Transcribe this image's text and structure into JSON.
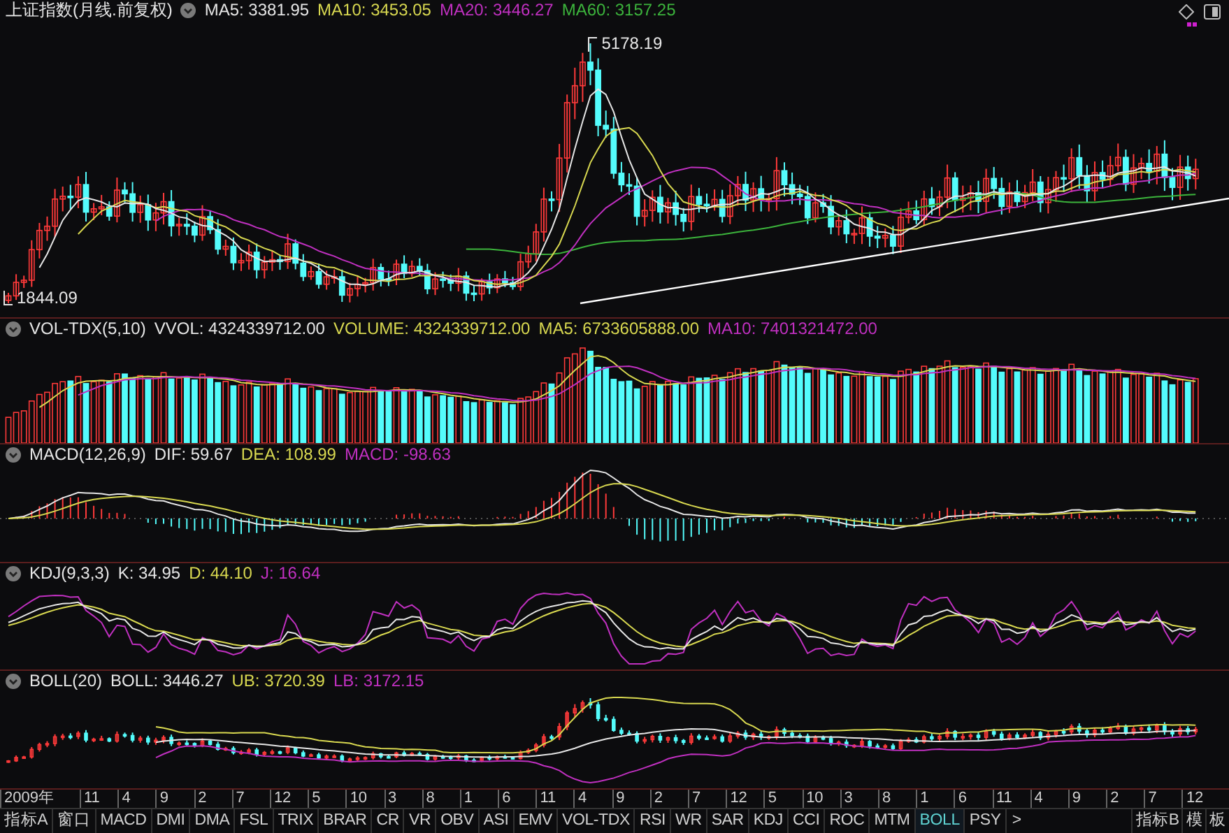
{
  "main_chart": {
    "title": "上证指数(月线.前复权)",
    "readings": [
      {
        "text": "MA5: 3381.95",
        "color": "#e6e6e6"
      },
      {
        "text": "MA10: 3453.05",
        "color": "#d8d850"
      },
      {
        "text": "MA20: 3446.27",
        "color": "#c030c0"
      },
      {
        "text": "MA60: 3157.25",
        "color": "#3cb43c"
      }
    ],
    "high_label": "5178.19",
    "low_label": "1844.09"
  },
  "indicators": [
    {
      "kind": "volume",
      "name": "VOL-TDX(5,10)",
      "readings": [
        {
          "text": "VVOL: 4324339712.00",
          "color": "#e6e6e6"
        },
        {
          "text": "VOLUME: 4324339712.00",
          "color": "#d8d850"
        },
        {
          "text": "MA5: 6733605888.00",
          "color": "#d8d850"
        },
        {
          "text": "MA10: 7401321472.00",
          "color": "#c030c0"
        }
      ]
    },
    {
      "kind": "macd",
      "name": "MACD(12,26,9)",
      "readings": [
        {
          "text": "DIF: 59.67",
          "color": "#e6e6e6"
        },
        {
          "text": "DEA: 108.99",
          "color": "#d8d850"
        },
        {
          "text": "MACD: -98.63",
          "color": "#c030c0"
        }
      ]
    },
    {
      "kind": "kdj",
      "name": "KDJ(9,3,3)",
      "readings": [
        {
          "text": "K: 34.95",
          "color": "#e6e6e6"
        },
        {
          "text": "D: 44.10",
          "color": "#d8d850"
        },
        {
          "text": "J: 16.64",
          "color": "#c030c0"
        }
      ]
    },
    {
      "kind": "boll",
      "name": "BOLL(20)",
      "readings": [
        {
          "text": "BOLL: 3446.27",
          "color": "#e6e6e6"
        },
        {
          "text": "UB: 3720.39",
          "color": "#d8d850"
        },
        {
          "text": "LB: 3172.15",
          "color": "#c030c0"
        }
      ]
    }
  ],
  "x_axis": [
    "2009年",
    "11",
    "4",
    "9",
    "2",
    "7",
    "12",
    "5",
    "10",
    "3",
    "8",
    "1",
    "6",
    "11",
    "4",
    "9",
    "2",
    "7",
    "12",
    "5",
    "10",
    "3",
    "8",
    "1",
    "6",
    "11",
    "4",
    "9",
    "2",
    "7",
    "12"
  ],
  "left_tabs": [
    {
      "label": "指标A",
      "selected": false
    },
    {
      "label": "窗口",
      "selected": false
    }
  ],
  "tabs": [
    {
      "label": "MACD",
      "selected": false
    },
    {
      "label": "DMI",
      "selected": false
    },
    {
      "label": "DMA",
      "selected": false
    },
    {
      "label": "FSL",
      "selected": false
    },
    {
      "label": "TRIX",
      "selected": false
    },
    {
      "label": "BRAR",
      "selected": false
    },
    {
      "label": "CR",
      "selected": false
    },
    {
      "label": "VR",
      "selected": false
    },
    {
      "label": "OBV",
      "selected": false
    },
    {
      "label": "ASI",
      "selected": false
    },
    {
      "label": "EMV",
      "selected": false
    },
    {
      "label": "VOL-TDX",
      "selected": false
    },
    {
      "label": "RSI",
      "selected": false
    },
    {
      "label": "WR",
      "selected": false
    },
    {
      "label": "SAR",
      "selected": false
    },
    {
      "label": "KDJ",
      "selected": false
    },
    {
      "label": "CCI",
      "selected": false
    },
    {
      "label": "ROC",
      "selected": false
    },
    {
      "label": "MTM",
      "selected": false
    },
    {
      "label": "BOLL",
      "selected": true
    },
    {
      "label": "PSY",
      "selected": false
    }
  ],
  "more_tabs": ">",
  "right_tabs": [
    "指标B",
    "模",
    "板"
  ]
}
